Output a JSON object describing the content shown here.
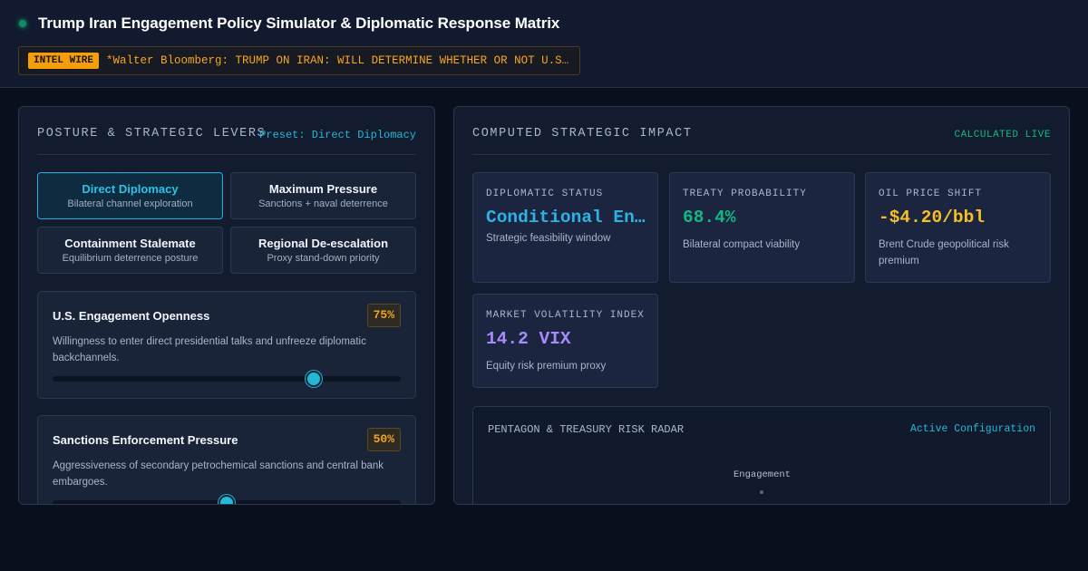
{
  "header": {
    "title": "Trump Iran Engagement Policy Simulator & Diplomatic Response Matrix",
    "ticker_badge": "INTEL WIRE",
    "ticker_text": "*Walter Bloomberg: TRUMP ON IRAN: WILL DETERMINE WHETHER OR NOT U.S.A. WILL ENGAGE"
  },
  "left_panel": {
    "title": "POSTURE & STRATEGIC LEVERS",
    "preset_label": "Preset: Direct Diplomacy",
    "presets": [
      {
        "name": "Direct Diplomacy",
        "desc": "Bilateral channel exploration",
        "active": true
      },
      {
        "name": "Maximum Pressure",
        "desc": "Sanctions + naval deterrence",
        "active": false
      },
      {
        "name": "Containment Stalemate",
        "desc": "Equilibrium deterrence posture",
        "active": false
      },
      {
        "name": "Regional De-escalation",
        "desc": "Proxy stand-down priority",
        "active": false
      }
    ],
    "levers": [
      {
        "title": "U.S. Engagement Openness",
        "value_text": "75%",
        "value": 75,
        "desc": "Willingness to enter direct presidential talks and unfreeze diplomatic backchannels."
      },
      {
        "title": "Sanctions Enforcement Pressure",
        "value_text": "50%",
        "value": 50,
        "desc": "Aggressiveness of secondary petrochemical sanctions and central bank embargoes."
      }
    ]
  },
  "right_panel": {
    "title": "COMPUTED STRATEGIC IMPACT",
    "live_label": "CALCULATED LIVE",
    "metrics": [
      {
        "label": "DIPLOMATIC STATUS",
        "value": "Conditional Engagement",
        "desc": "Strategic feasibility window",
        "color": "#2cb3e6"
      },
      {
        "label": "TREATY PROBABILITY",
        "value": "68.4%",
        "desc": "Bilateral compact viability",
        "color": "#10b981"
      },
      {
        "label": "OIL PRICE SHIFT",
        "value": "-$4.20/bbl",
        "desc": "Brent Crude geopolitical risk premium",
        "color": "#f6c025"
      },
      {
        "label": "MARKET VOLATILITY INDEX",
        "value": "14.2 VIX",
        "desc": "Equity risk premium proxy",
        "color": "#a78bfa"
      }
    ],
    "radar": {
      "title": "PENTAGON & TREASURY RISK RADAR",
      "tag": "Active Configuration",
      "axes": [
        "Engagement"
      ]
    }
  }
}
